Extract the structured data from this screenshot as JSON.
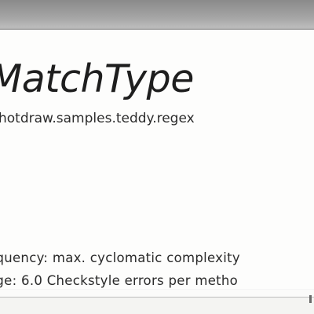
{
  "card": {
    "title": "MatchType",
    "package": "hotdraw.samples.teddy.regex",
    "metrics": [
      "equency: max. cyclomatic complexity",
      "age: 6.0 Checkstyle errors per metho"
    ]
  }
}
